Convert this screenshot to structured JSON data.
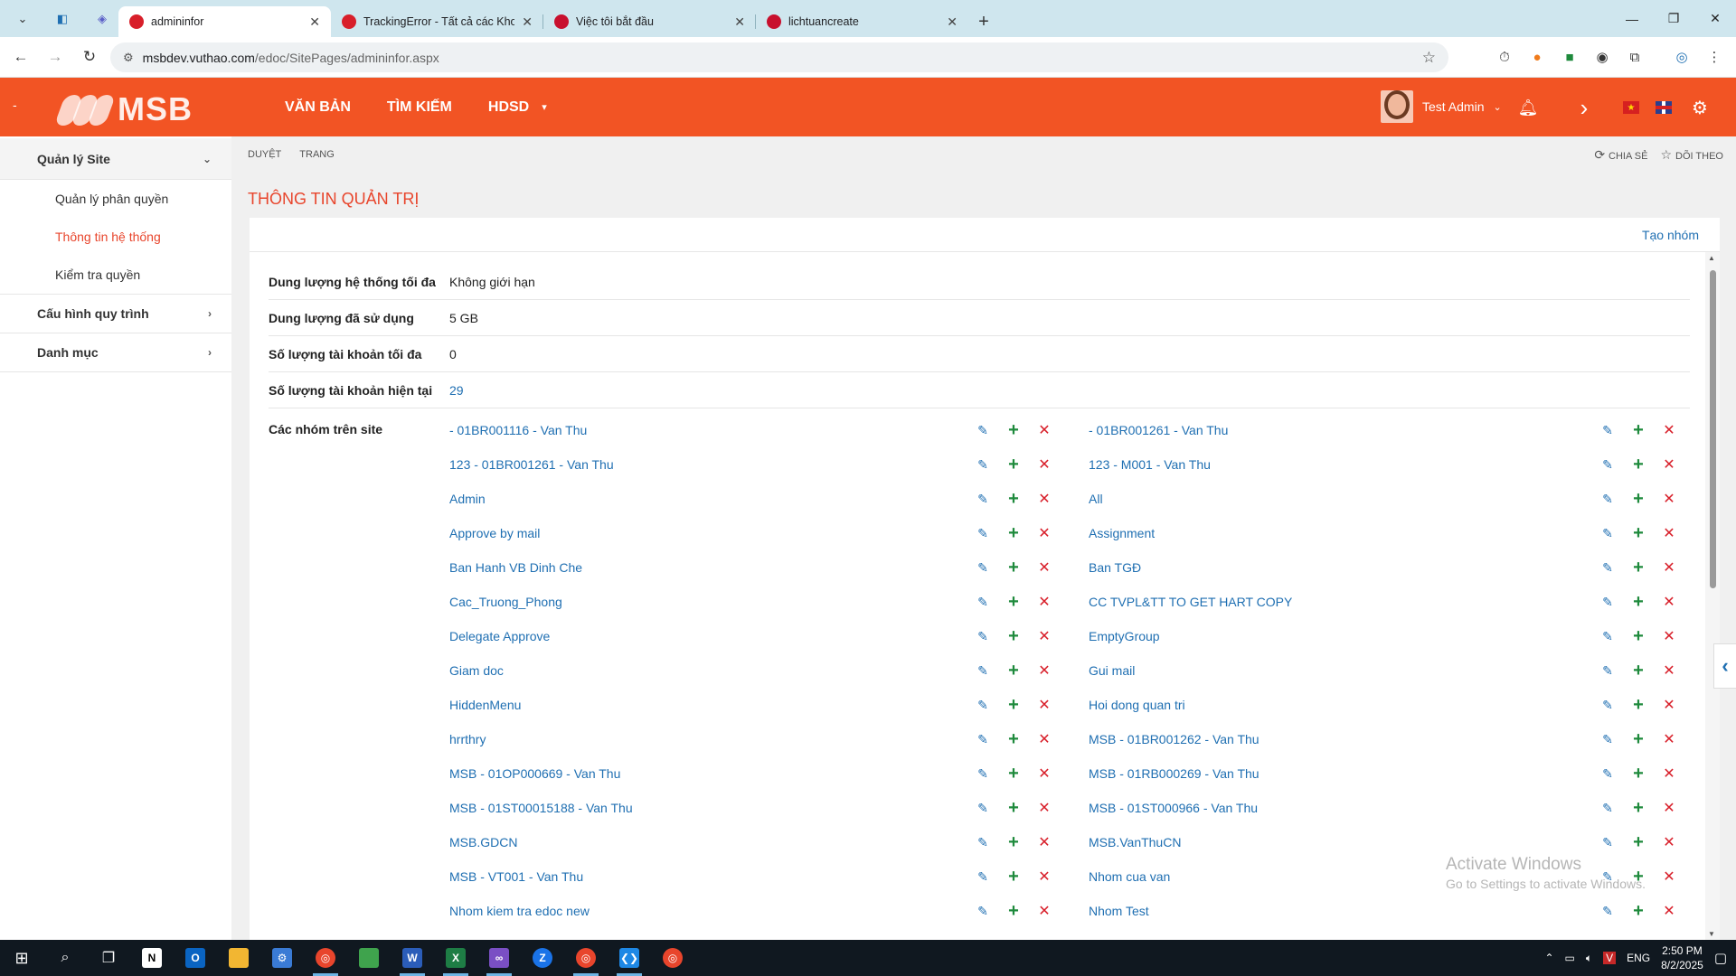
{
  "browser": {
    "tabs": [
      {
        "label": "admininfor",
        "active": true,
        "favicon_color": "#d81f2a"
      },
      {
        "label": "TrackingError - Tất cả các Khoản",
        "active": false,
        "favicon_color": "#d81f2a"
      },
      {
        "label": "Việc tôi bắt đầu",
        "active": false,
        "favicon_color": "#c8102e"
      },
      {
        "label": "lichtuancreate",
        "active": false,
        "favicon_color": "#c8102e"
      }
    ],
    "url_host": "msbdev.vuthao.com",
    "url_path": "/edoc/SitePages/admininfor.aspx",
    "window_controls": [
      "—",
      "❐",
      "✕"
    ]
  },
  "header": {
    "brand": "MSB",
    "nav": [
      "VĂN BẢN",
      "TÌM KIẾM",
      "HDSD"
    ],
    "user_name": "Test Admin",
    "accent_color": "#f25424"
  },
  "sidebar": {
    "groups": [
      {
        "label": "Quản lý Site",
        "expanded": true,
        "items": [
          {
            "label": "Quản lý phân quyền",
            "active": false
          },
          {
            "label": "Thông tin hệ thống",
            "active": true
          },
          {
            "label": "Kiểm tra quyền",
            "active": false
          }
        ]
      },
      {
        "label": "Cấu hình quy trình",
        "expanded": false,
        "items": []
      },
      {
        "label": "Danh mục",
        "expanded": false,
        "items": []
      }
    ]
  },
  "ribbon": {
    "left": [
      "DUYỆT",
      "TRANG"
    ],
    "share": "CHIA SẺ",
    "follow": "DÕI THEO"
  },
  "page": {
    "title": "THÔNG TIN QUẢN TRỊ",
    "create_group": "Tạo nhóm",
    "info_rows": [
      {
        "label": "Dung lượng hệ thống tối đa",
        "value": "Không giới hạn",
        "link": false
      },
      {
        "label": "Dung lượng đã sử dụng",
        "value": "5 GB",
        "link": false
      },
      {
        "label": "Số lượng tài khoản tối đa",
        "value": "0",
        "link": false
      },
      {
        "label": "Số lượng tài khoản hiện tại",
        "value": "29",
        "link": true
      }
    ],
    "groups_label": "Các nhóm trên site",
    "groups_left": [
      "- 01BR001116 - Van Thu",
      "123 - 01BR001261 - Van Thu",
      "Admin",
      "Approve by mail",
      "Ban Hanh VB Dinh Che",
      "Cac_Truong_Phong",
      "Delegate Approve",
      "Giam doc",
      "HiddenMenu",
      "hrrthry",
      "MSB - 01OP000669 - Van Thu",
      "MSB - 01ST00015188 - Van Thu",
      "MSB.GDCN",
      "MSB - VT001 - Van Thu",
      "Nhom kiem tra edoc new"
    ],
    "groups_right": [
      "- 01BR001261 - Van Thu",
      "123 - M001 - Van Thu",
      "All",
      "Assignment",
      "Ban TGĐ",
      "CC TVPL&TT TO GET HART COPY",
      "EmptyGroup",
      "Gui mail",
      "Hoi dong quan tri",
      "MSB - 01BR001262 - Van Thu",
      "MSB - 01RB000269 - Van Thu",
      "MSB - 01ST000966 - Van Thu",
      "MSB.VanThuCN",
      "Nhom cua van",
      "Nhom Test"
    ]
  },
  "watermark": {
    "line1": "Activate Windows",
    "line2": "Go to Settings to activate Windows."
  },
  "taskbar": {
    "lang": "ENG",
    "time": "2:50 PM",
    "date": "8/2/2025"
  }
}
